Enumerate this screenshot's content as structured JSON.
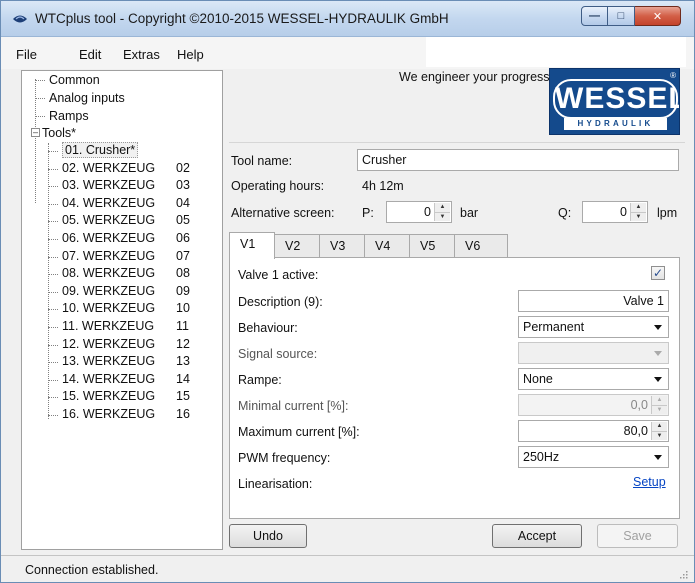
{
  "window": {
    "title": "WTCplus tool - Copyright ©2010-2015 WESSEL-HYDRAULIK GmbH"
  },
  "menu": [
    "File",
    "Edit",
    "Extras",
    "Help"
  ],
  "tree": {
    "items": [
      "Common",
      "Analog inputs",
      "Ramps"
    ],
    "tools_label": "Tools*",
    "tools": [
      {
        "name": "01. Crusher*",
        "num": ""
      },
      {
        "name": "02. WERKZEUG",
        "num": "02"
      },
      {
        "name": "03. WERKZEUG",
        "num": "03"
      },
      {
        "name": "04. WERKZEUG",
        "num": "04"
      },
      {
        "name": "05. WERKZEUG",
        "num": "05"
      },
      {
        "name": "06. WERKZEUG",
        "num": "06"
      },
      {
        "name": "07. WERKZEUG",
        "num": "07"
      },
      {
        "name": "08. WERKZEUG",
        "num": "08"
      },
      {
        "name": "09. WERKZEUG",
        "num": "09"
      },
      {
        "name": "10. WERKZEUG",
        "num": "10"
      },
      {
        "name": "11. WERKZEUG",
        "num": "11"
      },
      {
        "name": "12. WERKZEUG",
        "num": "12"
      },
      {
        "name": "13. WERKZEUG",
        "num": "13"
      },
      {
        "name": "14. WERKZEUG",
        "num": "14"
      },
      {
        "name": "15. WERKZEUG",
        "num": "15"
      },
      {
        "name": "16. WERKZEUG",
        "num": "16"
      }
    ]
  },
  "header": {
    "tagline": "We engineer your progress.",
    "logo_main": "WESSEL",
    "logo_sub": "HYDRAULIK",
    "logo_reg": "®"
  },
  "tool": {
    "name_label": "Tool name:",
    "name_value": "Crusher",
    "hours_label": "Operating hours:",
    "hours_value": "4h 12m",
    "alt_label": "Alternative screen:",
    "p_label": "P:",
    "p_value": "0",
    "p_unit": "bar",
    "q_label": "Q:",
    "q_value": "0",
    "q_unit": "lpm"
  },
  "tabs": [
    "V1",
    "V2",
    "V3",
    "V4",
    "V5",
    "V6"
  ],
  "valve": {
    "active_label": "Valve 1 active:",
    "active_mark": "✓",
    "desc_label": "Description (9):",
    "desc_value": "Valve 1",
    "behaviour_label": "Behaviour:",
    "behaviour_value": "Permanent",
    "signal_label": "Signal source:",
    "signal_value": "",
    "rampe_label": "Rampe:",
    "rampe_value": "None",
    "min_label": "Minimal current [%]:",
    "min_value": "0,0",
    "max_label": "Maximum current [%]:",
    "max_value": "80,0",
    "pwm_label": "PWM frequency:",
    "pwm_value": "250Hz",
    "lin_label": "Linearisation:",
    "lin_link": "Setup"
  },
  "buttons": {
    "undo": "Undo",
    "accept": "Accept",
    "save": "Save"
  },
  "status": {
    "text": "Connection established."
  }
}
